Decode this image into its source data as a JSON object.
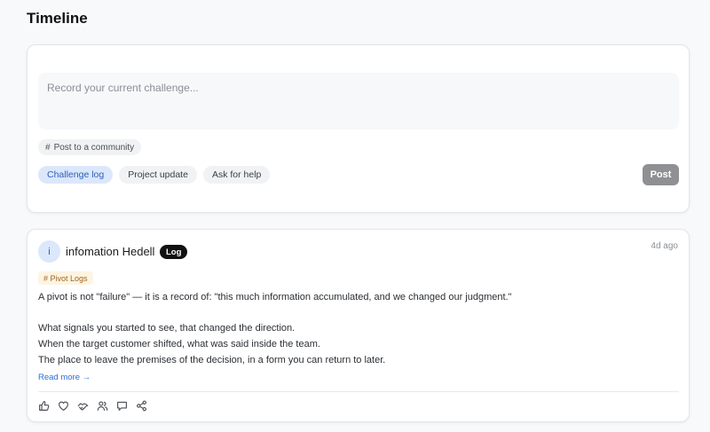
{
  "page": {
    "title": "Timeline"
  },
  "composer": {
    "placeholder": "Record your current challenge...",
    "community_chip": {
      "icon": "hash-icon",
      "label": "Post to a community"
    },
    "types": [
      {
        "label": "Challenge log",
        "active": true
      },
      {
        "label": "Project update",
        "active": false
      },
      {
        "label": "Ask for help",
        "active": false
      }
    ],
    "post_label": "Post"
  },
  "post": {
    "avatar_initial": "i",
    "author": "infomation Hedell",
    "badge": "Log",
    "timestamp": "4d ago",
    "tag": "# Pivot Logs",
    "lines": [
      "A pivot is not \"failure\" — it is a record of: \"this much information accumulated, and we changed our judgment.\"",
      "What signals you started to see, that changed the direction.",
      "When the target customer shifted, what was said inside the team.",
      "The place to leave the premises of the decision, in a form you can return to later."
    ],
    "read_more": "Read more →",
    "actions": [
      "thumbs-up-icon",
      "heart-icon",
      "handshake-icon",
      "users-icon",
      "comment-icon",
      "share-icon"
    ]
  },
  "colors": {
    "accent": "#2f6fd1",
    "active_chip_bg": "#dbe7fb",
    "post_button_bg": "#8e9093",
    "badge_bg": "#111111",
    "tag_bg": "#fdf4e3",
    "tag_text": "#a2651c"
  }
}
